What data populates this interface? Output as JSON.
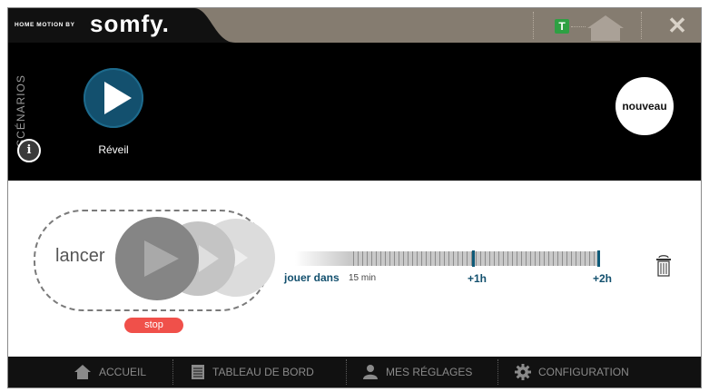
{
  "header": {
    "brand_small": "HOME MOTION BY",
    "brand_big": "somfy.",
    "badge_letter": "T",
    "close_glyph": "✕"
  },
  "scenarios": {
    "section_label": "SCÉNARIOS",
    "items": [
      {
        "label": "Réveil",
        "icon": "play-icon"
      }
    ],
    "new_label": "nouveau",
    "info_glyph": "i"
  },
  "player": {
    "launch_label": "lancer",
    "stop_label": "stop",
    "play_in_label": "jouer dans",
    "delay_value": "15 min",
    "tick_1h": "+1h",
    "tick_2h": "+2h"
  },
  "nav": {
    "items": [
      {
        "label": "ACCUEIL",
        "icon": "home-icon"
      },
      {
        "label": "TABLEAU DE BORD",
        "icon": "dashboard-icon"
      },
      {
        "label": "MES RÉGLAGES",
        "icon": "user-icon"
      },
      {
        "label": "CONFIGURATION",
        "icon": "gear-icon"
      }
    ]
  },
  "colors": {
    "topbar": "#857c70",
    "accent": "#13506e",
    "stop": "#f0504a",
    "badge": "#2ea043"
  }
}
